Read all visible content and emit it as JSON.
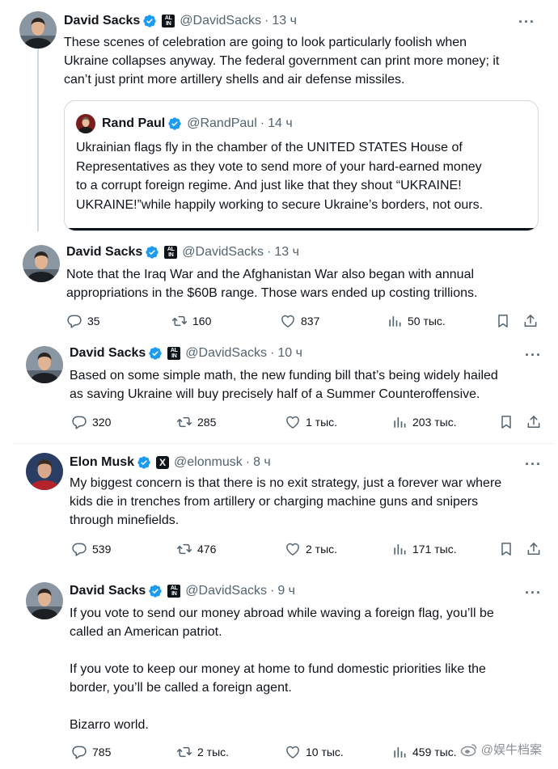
{
  "colors": {
    "accent": "#1d9bf0",
    "text": "#0f1419",
    "muted": "#536471",
    "border": "#cfd9de"
  },
  "tweets": [
    {
      "name": "David Sacks",
      "badge": "ALL IN",
      "handle": "@DavidSacks",
      "time": "13 ч",
      "text": "These scenes of celebration are going to look particularly foolish when\nUkraine collapses anyway. The federal government can print more money; it\ncan’t just print more artillery shells and air defense missiles.",
      "quote": {
        "name": "Rand Paul",
        "handle": "@RandPaul",
        "time": "14 ч",
        "text": "Ukrainian flags fly in the chamber of the UNITED STATES House of\nRepresentatives as they vote to send more of your hard-earned money\nto a corrupt foreign regime. And just like that they shout “UKRAINE!\nUKRAINE!”while happily working to secure Ukraine’s borders, not ours."
      }
    },
    {
      "name": "David Sacks",
      "badge": "ALL IN",
      "handle": "@DavidSacks",
      "time": "13 ч",
      "text": "Note that the Iraq War and the Afghanistan War also began with annual\nappropriations in the $60B range. Those wars ended up costing trillions.",
      "replies": "35",
      "reposts": "160",
      "likes": "837",
      "views": "50 тыс."
    },
    {
      "name": "David Sacks",
      "badge": "ALL IN",
      "handle": "@DavidSacks",
      "time": "10 ч",
      "text": "Based on some simple math, the new funding bill that’s being widely hailed\nas saving Ukraine will buy precisely half of a Summer Counteroffensive.",
      "replies": "320",
      "reposts": "285",
      "likes": "1 тыс.",
      "views": "203 тыс."
    },
    {
      "name": "Elon Musk",
      "badge": "X",
      "handle": "@elonmusk",
      "time": "8 ч",
      "text": "My biggest concern is that there is no exit strategy, just a forever war where\nkids die in trenches from artillery or charging machine guns and snipers\nthrough minefields.",
      "replies": "539",
      "reposts": "476",
      "likes": "2 тыс.",
      "views": "171 тыс."
    },
    {
      "name": "David Sacks",
      "badge": "ALL IN",
      "handle": "@DavidSacks",
      "time": "9 ч",
      "text": "If you vote to send our money abroad while waving a foreign flag, you’ll be\ncalled an American patriot.\n\nIf you vote to keep our money at home to fund domestic priorities like the\nborder, you’ll be called a foreign agent.\n\nBizarro world.",
      "replies": "785",
      "reposts": "2 тыс.",
      "likes": "10 тыс.",
      "views": "459 тыс."
    }
  ],
  "watermark": "@娱牛档案",
  "icons": [
    "verified-icon",
    "reply-icon",
    "repost-icon",
    "like-icon",
    "views-icon",
    "bookmark-icon",
    "share-icon",
    "more-icon",
    "weibo-icon"
  ]
}
